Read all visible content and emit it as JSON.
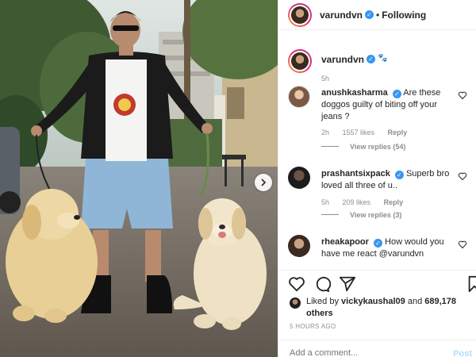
{
  "post": {
    "username": "varundvn",
    "dot": "•",
    "follow_label": "Following"
  },
  "caption": {
    "username": "varundvn",
    "emoji": "🐾",
    "time": "5h"
  },
  "comments": [
    {
      "username": "anushkasharma",
      "text": "Are these doggos guilty of biting off your jeans ?",
      "time": "2h",
      "likes": "1557 likes",
      "reply_label": "Reply",
      "view_replies": "View replies (54)"
    },
    {
      "username": "prashantsixpack",
      "text": "Superb bro loved all three of u..",
      "time": "5h",
      "likes": "209 likes",
      "reply_label": "Reply",
      "view_replies": "View replies (3)"
    },
    {
      "username": "rheakapoor",
      "text": "How would you have me react @varundvn",
      "time": "",
      "likes": "",
      "reply_label": "",
      "view_replies": ""
    }
  ],
  "likes": {
    "prefix": "Liked by",
    "user": "vickykaushal09",
    "middle": "and",
    "others": "689,178 others"
  },
  "timestamp": "5 HOURS AGO",
  "add_comment": {
    "placeholder": "Add a comment...",
    "post_label": "Post"
  },
  "icons": {
    "verified": "verified-badge-icon",
    "next": "chevron-right-icon",
    "like": "heart-icon",
    "comment": "comment-bubble-icon",
    "share": "paper-plane-icon",
    "save": "bookmark-icon"
  },
  "colors": {
    "verified": "#3897f0",
    "text": "#262626",
    "muted": "#8e8e8e",
    "post_disabled": "#b2dffc"
  }
}
